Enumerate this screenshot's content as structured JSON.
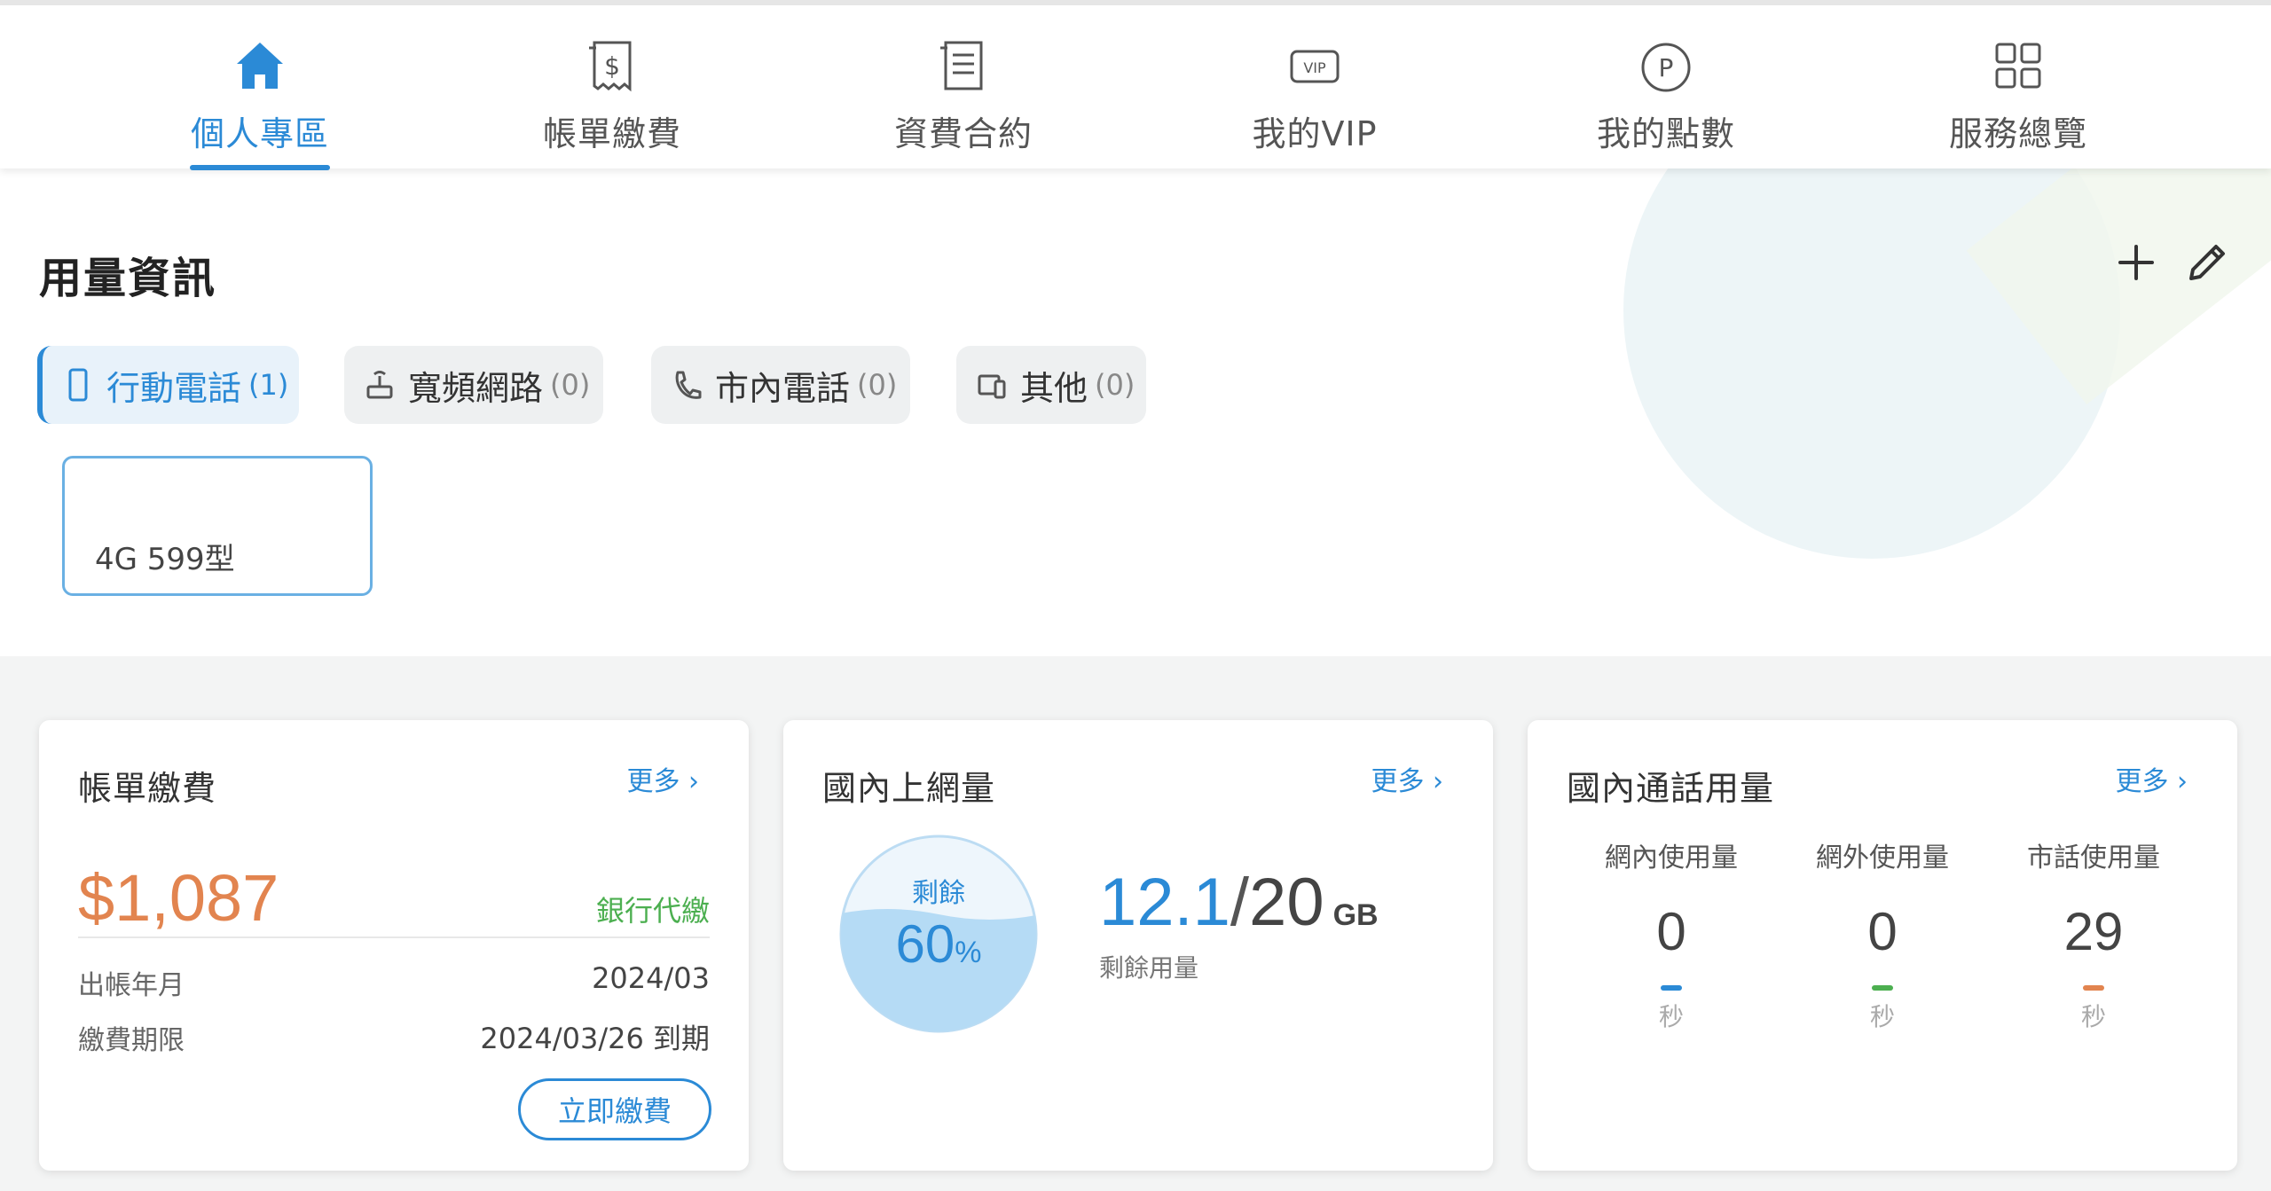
{
  "nav": {
    "items": [
      {
        "label": "個人專區",
        "icon": "home-icon"
      },
      {
        "label": "帳單繳費",
        "icon": "bill-dollar-icon"
      },
      {
        "label": "資費合約",
        "icon": "contract-document-icon"
      },
      {
        "label": "我的VIP",
        "icon": "vip-icon"
      },
      {
        "label": "我的點數",
        "icon": "points-icon"
      },
      {
        "label": "服務總覽",
        "icon": "grid-icon"
      }
    ],
    "active_index": 0
  },
  "usage": {
    "title": "用量資訊",
    "tabs": [
      {
        "label": "行動電話",
        "count": "(1)",
        "icon": "mobile-phone-icon"
      },
      {
        "label": "寬頻網路",
        "count": "(0)",
        "icon": "router-icon"
      },
      {
        "label": "市內電話",
        "count": "(0)",
        "icon": "phone-handset-icon"
      },
      {
        "label": "其他",
        "count": "(0)",
        "icon": "devices-icon"
      }
    ],
    "plan": "4G 599型"
  },
  "bill_card": {
    "title": "帳單繳費",
    "more": "更多 ›",
    "amount": "$1,087",
    "pay_method": "銀行代繳",
    "period_label": "出帳年月",
    "period_value": "2024/03",
    "due_label": "繳費期限",
    "due_value": "2024/03/26 到期",
    "pay_button": "立即繳費"
  },
  "data_card": {
    "title": "國內上網量",
    "more": "更多 ›",
    "gauge_label": "剩餘",
    "percent_value": "60",
    "percent_unit": "%",
    "remaining_fraction": 0.6,
    "remaining": "12.1",
    "slash": "/",
    "total": "20",
    "unit": "GB",
    "sublabel": "剩餘用量"
  },
  "call_card": {
    "title": "國內通話用量",
    "more": "更多 ›",
    "columns": [
      {
        "label": "網內使用量",
        "value": "0",
        "unit": "秒",
        "color": "#2b8ad6"
      },
      {
        "label": "網外使用量",
        "value": "0",
        "unit": "秒",
        "color": "#4caf50"
      },
      {
        "label": "市話使用量",
        "value": "29",
        "unit": "秒",
        "color": "#e2844f"
      }
    ]
  },
  "colors": {
    "accent": "#2b8ad6",
    "amount": "#e2844f",
    "success": "#4caf50"
  }
}
